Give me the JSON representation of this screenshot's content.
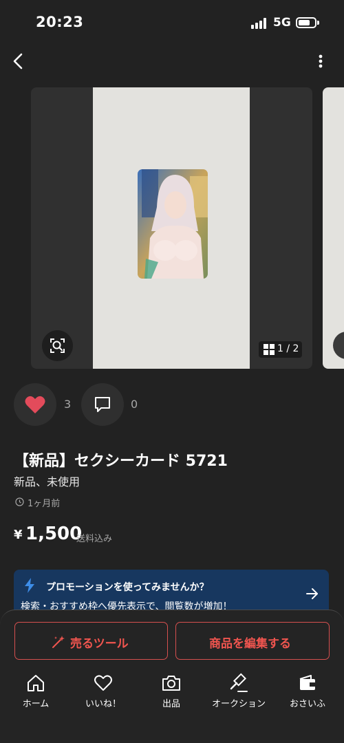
{
  "status_bar": {
    "time": "20:23",
    "network": "5G"
  },
  "carousel": {
    "counter": "1 / 2"
  },
  "social": {
    "likes": "3",
    "comments": "0"
  },
  "item": {
    "title": "【新品】セクシーカード 5721",
    "condition": "新品、未使用",
    "posted": "1ヶ月前",
    "currency": "¥",
    "price": "1,500",
    "shipping": "送料込み"
  },
  "promo": {
    "title": "プロモーションを使ってみませんか？",
    "body": "検索・おすすめ枠へ優先表示で、閲覧数が増加！"
  },
  "actions": {
    "sell_tools": "売るツール",
    "edit": "商品を編集する"
  },
  "tabs": [
    {
      "label": "ホーム",
      "icon": "home-icon"
    },
    {
      "label": "いいね！",
      "icon": "heart-icon"
    },
    {
      "label": "出品",
      "icon": "camera-icon"
    },
    {
      "label": "オークション",
      "icon": "gavel-icon"
    },
    {
      "label": "おさいふ",
      "icon": "wallet-icon"
    }
  ],
  "colors": {
    "background": "#222222",
    "accent": "#f0554f",
    "like": "#e34b5b",
    "promo": "#17375f",
    "bolt": "#3d8de8"
  }
}
